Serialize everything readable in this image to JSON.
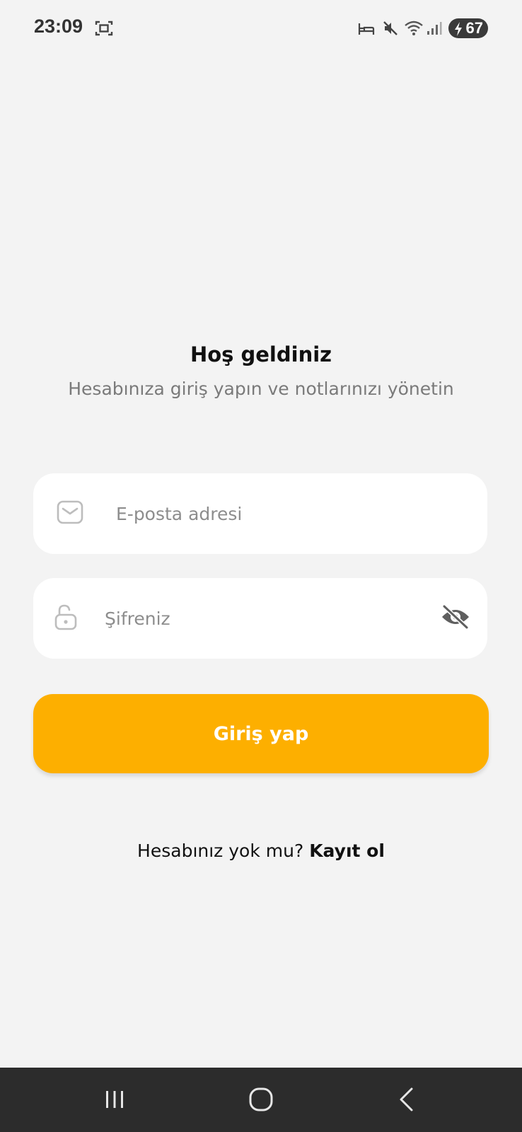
{
  "status_bar": {
    "time": "23:09",
    "battery": "67",
    "icons": [
      "screenshot-icon",
      "bed-icon",
      "mute-icon",
      "wifi-icon",
      "signal-icon",
      "charging-bolt-icon"
    ]
  },
  "welcome": {
    "title": "Hoş geldiniz",
    "subtitle": "Hesabınıza giriş yapın ve notlarınızı yönetin"
  },
  "form": {
    "email": {
      "placeholder": "E-posta adresi",
      "value": "",
      "icon": "mail-icon"
    },
    "password": {
      "placeholder": "Şifreniz",
      "value": "",
      "icon": "unlock-icon",
      "toggle_icon": "eye-off-icon"
    },
    "login_label": "Giriş yap"
  },
  "register": {
    "prompt": "Hesabınız yok mu?",
    "link": "Kayıt ol"
  },
  "nav_bar": {
    "buttons": [
      "recent-apps-icon",
      "home-icon",
      "back-icon"
    ]
  },
  "colors": {
    "background": "#f3f3f3",
    "accent": "#fdaf00",
    "field_background": "#ffffff",
    "nav_bar": "#2c2c2c",
    "subtitle_text": "#7a7a7a",
    "placeholder_text": "#8d8d8d"
  }
}
